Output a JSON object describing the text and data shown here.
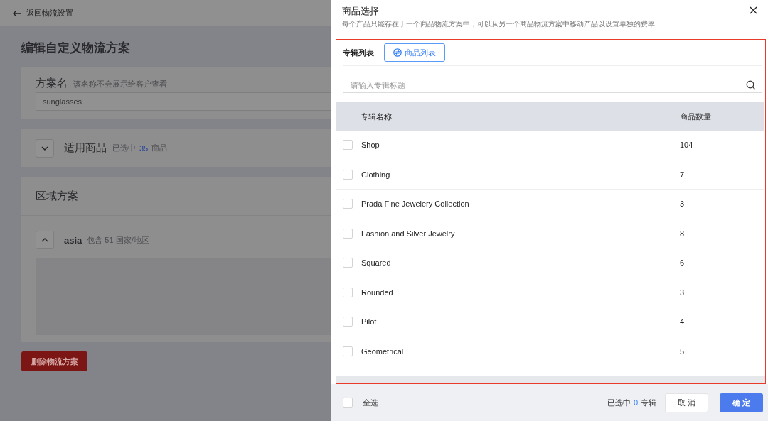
{
  "page": {
    "back_link": "返回物流设置",
    "title": "编辑自定义物流方案",
    "plan_name": {
      "label": "方案名",
      "hint": "该名称不会展示给客户查看",
      "value": "sunglasses"
    },
    "products": {
      "title": "适用商品",
      "expanded": false,
      "prefix": "已选中",
      "count": "35",
      "suffix": "商品"
    },
    "regions": {
      "title": "区域方案",
      "zone": {
        "name": "asia",
        "expanded": true,
        "summary": "包含 51 国家/地区"
      }
    },
    "delete_button": "删除物流方案"
  },
  "drawer": {
    "title": "商品选择",
    "subtitle": "每个产品只能存在于一个商品物流方案中；可以从另一个商品物流方案中移动产品以设置单独的费率",
    "tabs": [
      {
        "label": "专辑列表",
        "selected": true,
        "kind": "text"
      },
      {
        "label": "商品列表",
        "selected": false,
        "kind": "button"
      }
    ],
    "search": {
      "placeholder": "请输入专辑标题"
    },
    "table": {
      "columns": [
        "专辑名称",
        "商品数量"
      ],
      "rows": [
        {
          "name": "Shop",
          "count": "104",
          "checked": false
        },
        {
          "name": "Clothing",
          "count": "7",
          "checked": false
        },
        {
          "name": "Prada Fine Jewelery Collection",
          "count": "3",
          "checked": false
        },
        {
          "name": "Fashion and Silver Jewelry",
          "count": "8",
          "checked": false
        },
        {
          "name": "Squared",
          "count": "6",
          "checked": false
        },
        {
          "name": "Rounded",
          "count": "3",
          "checked": false
        },
        {
          "name": "Pilot",
          "count": "4",
          "checked": false
        },
        {
          "name": "Geometrical",
          "count": "5",
          "checked": false
        }
      ]
    },
    "footer": {
      "select_all": {
        "label": "全选",
        "checked": false
      },
      "prefix": "已选中",
      "count": "0",
      "suffix": "专辑",
      "cancel": "取 消",
      "confirm": "确 定"
    }
  }
}
